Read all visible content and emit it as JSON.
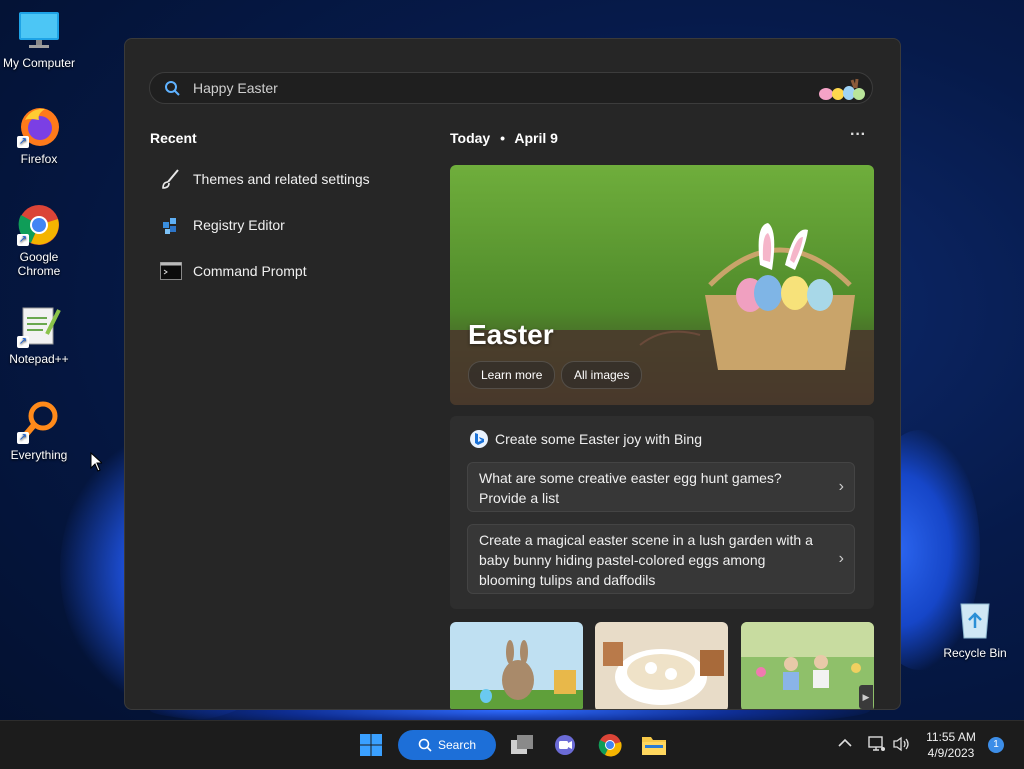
{
  "desktop": {
    "icons": [
      {
        "label": "My Computer"
      },
      {
        "label": "Firefox"
      },
      {
        "label": "Google Chrome"
      },
      {
        "label": "Notepad++"
      },
      {
        "label": "Everything"
      },
      {
        "label": "Recycle Bin"
      }
    ]
  },
  "start_panel": {
    "search": {
      "value": "Happy Easter",
      "icon": "search-icon"
    },
    "recent": {
      "title": "Recent",
      "items": [
        {
          "label": "Themes and related settings",
          "icon": "brush-icon"
        },
        {
          "label": "Registry Editor",
          "icon": "registry-icon"
        },
        {
          "label": "Command Prompt",
          "icon": "cmd-icon"
        }
      ]
    },
    "today": {
      "label": "Today",
      "separator": "•",
      "date": "April 9",
      "more": "···"
    },
    "hero": {
      "title": "Easter",
      "buttons": [
        "Learn more",
        "All images"
      ]
    },
    "bing": {
      "heading": "Create some Easter joy with Bing",
      "prompts": [
        "What are some creative easter egg hunt games? Provide a list",
        "Create a magical easter scene in a lush garden with a baby bunny hiding pastel-colored eggs among blooming tulips and daffodils"
      ]
    }
  },
  "taskbar": {
    "search_label": "Search",
    "clock": {
      "time": "11:55 AM",
      "date": "4/9/2023"
    },
    "notification_count": "1"
  },
  "colors": {
    "accent": "#1d6fd8",
    "panel_bg": "#262626",
    "taskbar_bg": "#1c1c1c"
  }
}
